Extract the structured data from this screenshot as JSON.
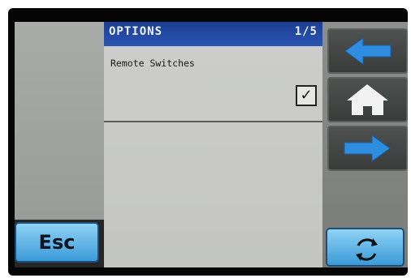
{
  "screen": {
    "title": "OPTIONS",
    "page_indicator": "1/5"
  },
  "options": [
    {
      "label": "Remote Switches",
      "checked": true,
      "check_glyph": "✓"
    }
  ],
  "buttons": {
    "esc_label": "Esc",
    "back_icon": "left-arrow-icon",
    "home_icon": "home-icon",
    "next_icon": "right-arrow-icon",
    "refresh_icon": "refresh-icon"
  },
  "colors": {
    "title_bar": "#1f4599",
    "arrow_blue": "#2f8de0",
    "esc_button": "#5fb6e8"
  }
}
